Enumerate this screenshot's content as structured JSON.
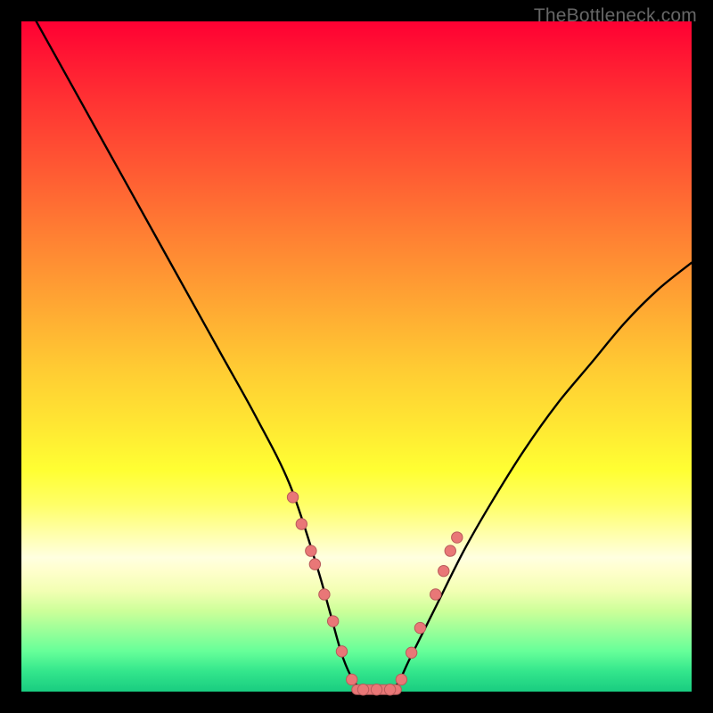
{
  "watermark": "TheBottleneck.com",
  "colors": {
    "frame_border": "#000000",
    "curve_stroke": "#000000",
    "marker_fill": "#e97777",
    "marker_stroke": "#b85a5a"
  },
  "chart_data": {
    "type": "line",
    "title": "",
    "xlabel": "",
    "ylabel": "",
    "xlim": [
      0,
      100
    ],
    "ylim": [
      0,
      100
    ],
    "grid": false,
    "legend": false,
    "series": [
      {
        "name": "bottleneck-curve",
        "x": [
          0,
          5,
          10,
          15,
          20,
          25,
          30,
          35,
          40,
          44,
          46,
          48,
          50,
          52,
          54,
          56,
          58,
          62,
          66,
          70,
          75,
          80,
          85,
          90,
          95,
          100
        ],
        "y": [
          104,
          95,
          86,
          77,
          68,
          59,
          50,
          41,
          31,
          19,
          12,
          5,
          1,
          0,
          0,
          1,
          5,
          13,
          21,
          28,
          36,
          43,
          49,
          55,
          60,
          64
        ]
      }
    ],
    "markers": [
      {
        "x": 40.5,
        "y": 29
      },
      {
        "x": 41.8,
        "y": 25
      },
      {
        "x": 43.2,
        "y": 21
      },
      {
        "x": 43.8,
        "y": 19
      },
      {
        "x": 45.2,
        "y": 14.5
      },
      {
        "x": 46.5,
        "y": 10.5
      },
      {
        "x": 47.8,
        "y": 6
      },
      {
        "x": 49.3,
        "y": 1.8
      },
      {
        "x": 51.0,
        "y": 0.3
      },
      {
        "x": 53.0,
        "y": 0.3
      },
      {
        "x": 55.0,
        "y": 0.3
      },
      {
        "x": 56.7,
        "y": 1.8
      },
      {
        "x": 58.2,
        "y": 5.8
      },
      {
        "x": 59.5,
        "y": 9.5
      },
      {
        "x": 61.8,
        "y": 14.5
      },
      {
        "x": 63.0,
        "y": 18
      },
      {
        "x": 64.0,
        "y": 21
      },
      {
        "x": 65.0,
        "y": 23
      }
    ],
    "bottom_bar": {
      "x_start": 49.3,
      "x_end": 56.7,
      "y": 0.3
    }
  }
}
